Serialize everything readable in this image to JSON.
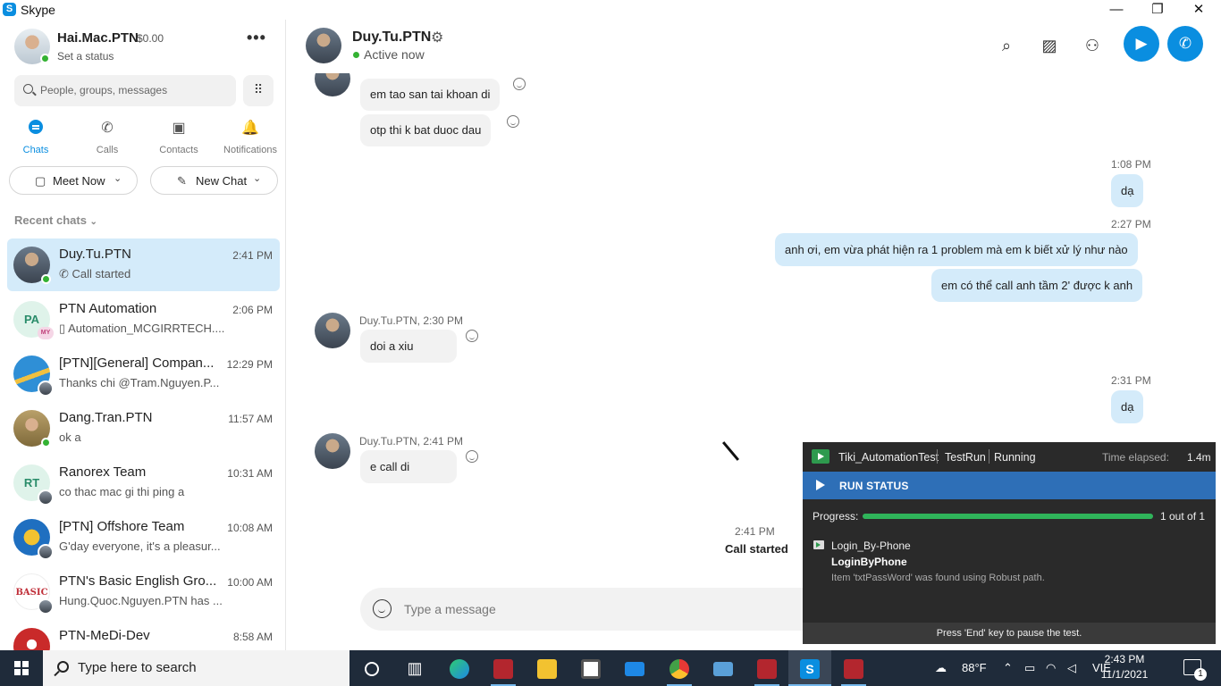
{
  "window": {
    "title": "Skype",
    "app_icon": "S",
    "minimize": "—",
    "restore": "❐",
    "close": "✕"
  },
  "profile": {
    "name": "Hai.Mac.PTN",
    "credit": "$0.00",
    "status": "Set a status",
    "more": "•••"
  },
  "search": {
    "placeholder": "People, groups, messages"
  },
  "nav": [
    {
      "label": "Chats",
      "icon": "chat-icon"
    },
    {
      "label": "Calls",
      "icon": "phone-icon",
      "glyph": "✆"
    },
    {
      "label": "Contacts",
      "icon": "contacts-icon",
      "glyph": "▣"
    },
    {
      "label": "Notifications",
      "icon": "bell-icon",
      "glyph": "🔔"
    }
  ],
  "actions": {
    "meet_now": "Meet Now",
    "new_chat": "New Chat"
  },
  "recent_header": "Recent chats",
  "chats": [
    {
      "name": "Duy.Tu.PTN",
      "time": "2:41 PM",
      "preview": "Call started",
      "icon": "phone-icon"
    },
    {
      "name": "PTN Automation",
      "time": "2:06 PM",
      "preview": "Automation_MCGIRRTECH....",
      "initials": "PA",
      "badge": "MY"
    },
    {
      "name": "[PTN][General] Compan...",
      "time": "12:29 PM",
      "preview": "Thanks chi @Tram.Nguyen.P..."
    },
    {
      "name": "Dang.Tran.PTN",
      "time": "11:57 AM",
      "preview": "ok a"
    },
    {
      "name": "Ranorex Team",
      "time": "10:31 AM",
      "preview": "co thac mac gi thi ping a",
      "initials": "RT"
    },
    {
      "name": "[PTN] Offshore Team",
      "time": "10:08 AM",
      "preview": "G'day everyone, it's a pleasur..."
    },
    {
      "name": "PTN's Basic English Gro...",
      "time": "10:00 AM",
      "preview": "Hung.Quoc.Nguyen.PTN has ...",
      "initials": "BASIC"
    },
    {
      "name": "PTN-MeDi-Dev",
      "time": "8:58 AM",
      "preview": ""
    }
  ],
  "conversation": {
    "name": "Duy.Tu.PTN",
    "status": "Active now"
  },
  "messages": {
    "m1": "em tao san tai khoan di",
    "m2": "otp thi k bat duoc dau",
    "t3": "1:08 PM",
    "m3": "dạ",
    "t4": "2:27 PM",
    "m4": "anh ơi, em vừa phát hiện ra 1 problem mà em k biết xử lý như nào",
    "m5": "em có thể call anh tầm 2' được k anh",
    "meta6": "Duy.Tu.PTN, 2:30 PM",
    "m6": "doi a xiu",
    "t7": "2:31 PM",
    "m7": "dạ",
    "meta8": "Duy.Tu.PTN, 2:41 PM",
    "m8": "e call di",
    "call_time": "2:41 PM",
    "call_text": "Call started"
  },
  "compose": {
    "placeholder": "Type a message"
  },
  "ranorex": {
    "test_suite": "Tiki_AutomationTest",
    "run": "TestRun",
    "state": "Running",
    "elapsed_label": "Time elapsed:",
    "elapsed": "1.4m",
    "status_label": "RUN STATUS",
    "progress_label": "Progress:",
    "progress_fraction": 1.0,
    "progress_count": "1 out of 1",
    "test_case": "Login_By-Phone",
    "module": "LoginByPhone",
    "detail": "Item 'txtPassWord' was found using Robust path.",
    "footer": "Press 'End' key to pause the test."
  },
  "taskbar": {
    "search_placeholder": "Type here to search",
    "weather": "88°F",
    "language": "VIE",
    "time": "2:43 PM",
    "date": "11/1/2021",
    "notifications": "1"
  },
  "colors": {
    "accent": "#0a8ee0",
    "presence": "#34b233",
    "selected": "#d4ebfa",
    "bubble_mine": "#d4ebfa",
    "bubble_theirs": "#f2f2f2",
    "taskbar": "#1f2b3a",
    "ranorex_bar": "#2e6fb7"
  }
}
